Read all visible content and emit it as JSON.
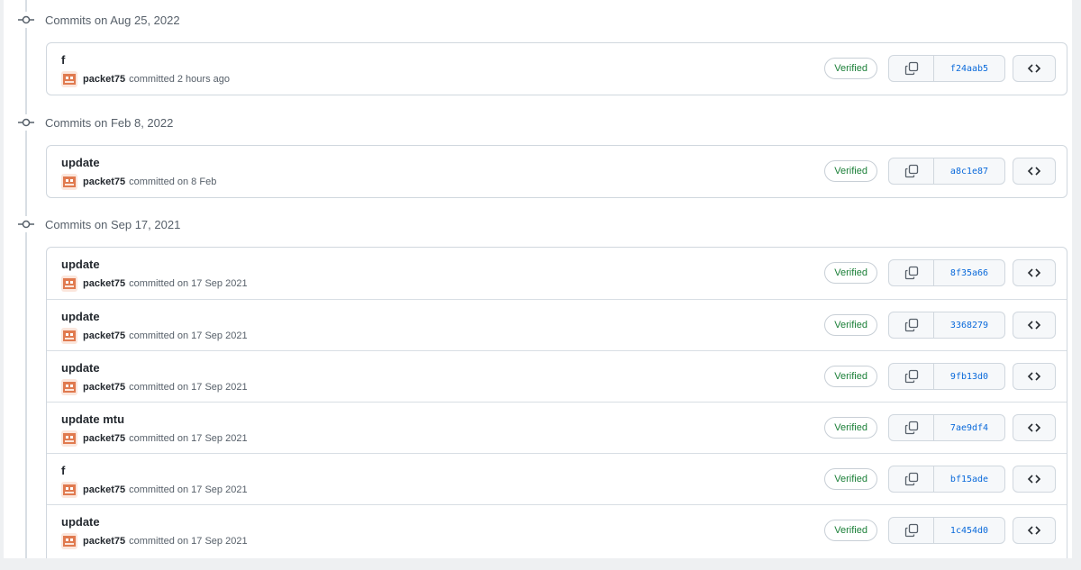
{
  "verified_label": "Verified",
  "colors": {
    "verified": "#1a7f37",
    "sha": "#0969da",
    "border": "#d0d7de"
  },
  "icons": {
    "node": "git-commit-icon",
    "copy": "copy-icon",
    "browse": "code-brackets-icon",
    "avatar": "user-avatar-icon"
  },
  "groups": [
    {
      "title": "Commits on Aug 25, 2022",
      "commits": [
        {
          "message": "f",
          "author": "packet75",
          "time": "committed 2 hours ago",
          "sha": "f24aab5"
        }
      ]
    },
    {
      "title": "Commits on Feb 8, 2022",
      "commits": [
        {
          "message": "update",
          "author": "packet75",
          "time": "committed on 8 Feb",
          "sha": "a8c1e87"
        }
      ]
    },
    {
      "title": "Commits on Sep 17, 2021",
      "commits": [
        {
          "message": "update",
          "author": "packet75",
          "time": "committed on 17 Sep 2021",
          "sha": "8f35a66"
        },
        {
          "message": "update",
          "author": "packet75",
          "time": "committed on 17 Sep 2021",
          "sha": "3368279"
        },
        {
          "message": "update",
          "author": "packet75",
          "time": "committed on 17 Sep 2021",
          "sha": "9fb13d0"
        },
        {
          "message": "update mtu",
          "author": "packet75",
          "time": "committed on 17 Sep 2021",
          "sha": "7ae9df4"
        },
        {
          "message": "f",
          "author": "packet75",
          "time": "committed on 17 Sep 2021",
          "sha": "bf15ade"
        },
        {
          "message": "update",
          "author": "packet75",
          "time": "committed on 17 Sep 2021",
          "sha": "1c454d0"
        }
      ]
    }
  ]
}
